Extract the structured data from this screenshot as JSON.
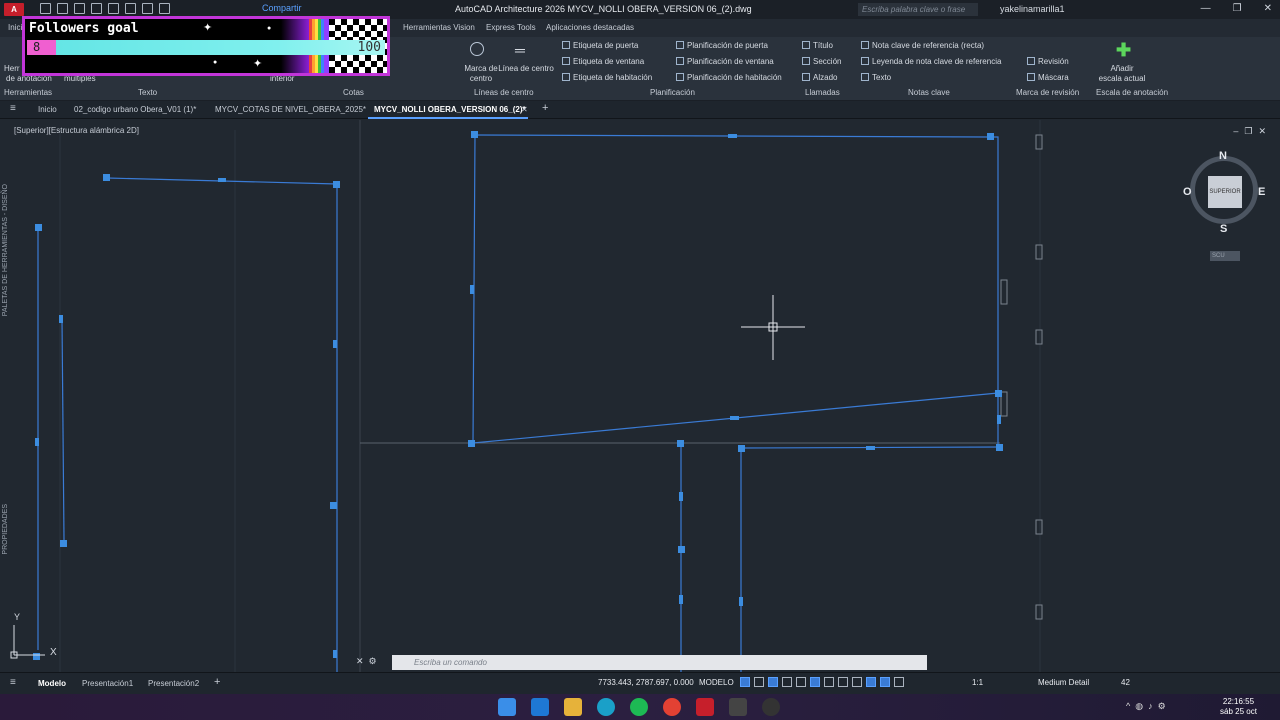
{
  "titlebar": {
    "logo": "A",
    "share": "Compartir",
    "title": "AutoCAD Architecture 2026   MYCV_NOLLI OBERA_VERSION 06_(2).dwg",
    "search_placeholder": "Escriba palabra clave o frase",
    "user": "yakelinamarilla1",
    "buttons": [
      "—",
      "❐",
      "✕"
    ]
  },
  "ribbon_tabs": [
    "Inicio",
    "Herramientas Vision",
    "Express Tools",
    "Aplicaciones destacadas"
  ],
  "ribbon": {
    "left_labels": [
      "Herr",
      "de anotación",
      "múltiples",
      "interior"
    ],
    "centro": {
      "marca": "Marca de centro",
      "linea": "Línea de centro"
    },
    "etiquetas": [
      "Etiqueta de puerta",
      "Etiqueta de ventana",
      "Etiqueta de habitación"
    ],
    "planificacion": [
      "Planificación de puerta",
      "Planificación de ventana",
      "Planificación de habitación"
    ],
    "llamadas": [
      "Título",
      "Sección",
      "Alzado"
    ],
    "notas": [
      "Nota clave de referencia (recta)",
      "Leyenda de nota clave de referencia",
      "Texto"
    ],
    "revision": [
      "Revisión",
      "Máscara"
    ],
    "anotacion": "Añadir escala actual",
    "panel_titles": [
      "Herramientas",
      "Texto",
      "Cotas",
      "Líneas de centro",
      "Planificación",
      "Llamadas",
      "Notas clave",
      "Marca de revisión",
      "Escala de anotación"
    ]
  },
  "followers": {
    "title": "Followers goal",
    "current": "8",
    "goal": "100",
    "progress": 0.08
  },
  "doc_tabs": {
    "menu": "≡",
    "items": [
      "Inicio",
      "02_codigo urbano Obera_V01 (1)*",
      "MYCV_COTAS DE NIVEL_OBERA_2025*",
      "MYCV_NOLLI OBERA_VERSION 06_(2)*"
    ],
    "close": "✕",
    "add": "+"
  },
  "viewport": {
    "label": "[Superior][Estructura alámbrica 2D]",
    "side_labels": [
      "PALETAS DE HERRAMIENTAS - DISEÑO",
      "PROPIEDADES"
    ],
    "controls": [
      "–",
      "❐",
      "✕"
    ],
    "viewcube": {
      "n": "N",
      "s": "S",
      "e": "E",
      "w": "O",
      "face": "SUPERIOR"
    },
    "scu": "SCU",
    "ucs": {
      "y": "Y",
      "x": "X"
    }
  },
  "command_line": {
    "placeholder": "Escriba un comando"
  },
  "layout_tabs": [
    "Modelo",
    "Presentación1",
    "Presentación2",
    "+"
  ],
  "status": {
    "coords": "7733.443, 2787.697, 0.000",
    "model": "MODELO",
    "scale": "1:1",
    "detail": "Medium Detail",
    "num": "42"
  },
  "taskbar": {
    "time": "22:16:55",
    "date": "sáb 25 oct"
  },
  "colors": {
    "canvas": "#212830",
    "lines": "#3a7bd5",
    "grips": "#3c8de0",
    "accent": "#c235d9"
  }
}
